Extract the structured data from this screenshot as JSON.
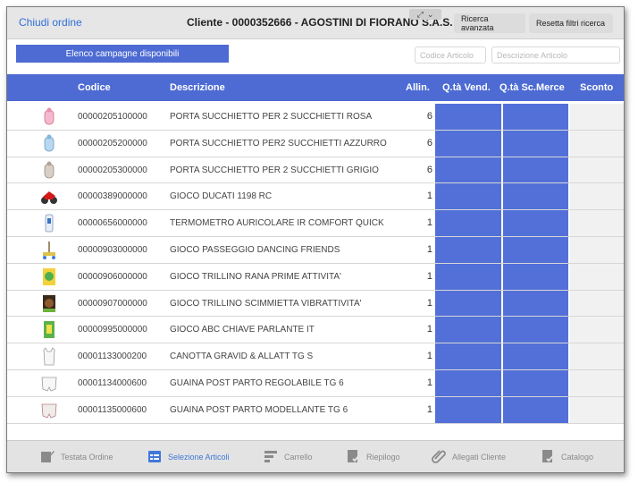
{
  "header": {
    "close_label": "Chiudi ordine",
    "client_title": "Cliente - 0000352666 - AGOSTINI DI FIORANO S.A.S.",
    "advanced_search_label": "Ricerca avanzata",
    "reset_filters_label": "Resetta filtri ricerca"
  },
  "toolbar": {
    "campaigns_label": "Elenco campagne disponibili",
    "code_placeholder": "Codice Articolo",
    "desc_placeholder": "Descrizione Articolo"
  },
  "table": {
    "columns": {
      "code": "Codice",
      "description": "Descrizione",
      "allin": "Allin.",
      "qty_sold": "Q.tà Vend.",
      "qty_discount": "Q.tà Sc.Merce",
      "discount": "Sconto"
    },
    "rows": [
      {
        "code": "00000205100000",
        "description": "PORTA SUCCHIETTO PER 2 SUCCHIETTI ROSA",
        "allin": "6",
        "thumb": "pacifier-holder-pink-icon"
      },
      {
        "code": "00000205200000",
        "description": "PORTA SUCCHIETTO PER2 SUCCHIETTI AZZURRO",
        "allin": "6",
        "thumb": "pacifier-holder-blue-icon"
      },
      {
        "code": "00000205300000",
        "description": "PORTA SUCCHIETTO PER 2 SUCCHIETTI GRIGIO",
        "allin": "6",
        "thumb": "pacifier-holder-grey-icon"
      },
      {
        "code": "00000389000000",
        "description": "GIOCO DUCATI 1198 RC",
        "allin": "1",
        "thumb": "motorbike-toy-icon"
      },
      {
        "code": "00000656000000",
        "description": "TERMOMETRO AURICOLARE IR COMFORT QUICK",
        "allin": "1",
        "thumb": "thermometer-icon"
      },
      {
        "code": "00000903000000",
        "description": "GIOCO PASSEGGIO DANCING FRIENDS",
        "allin": "1",
        "thumb": "stroller-toy-icon"
      },
      {
        "code": "00000906000000",
        "description": "GIOCO TRILLINO RANA PRIME ATTIVITA'",
        "allin": "1",
        "thumb": "frog-rattle-icon"
      },
      {
        "code": "00000907000000",
        "description": "GIOCO TRILLINO SCIMMIETTA VIBRATTIVITA'",
        "allin": "1",
        "thumb": "monkey-rattle-icon"
      },
      {
        "code": "00000995000000",
        "description": "GIOCO ABC CHIAVE PARLANTE IT",
        "allin": "1",
        "thumb": "key-toy-icon"
      },
      {
        "code": "00001133000200",
        "description": "CANOTTA GRAVID & ALLATT TG S",
        "allin": "1",
        "thumb": "tank-top-icon"
      },
      {
        "code": "00001134000600",
        "description": "GUAINA POST PARTO REGOLABILE TG 6",
        "allin": "1",
        "thumb": "girdle-icon"
      },
      {
        "code": "00001135000600",
        "description": "GUAINA POST PARTO MODELLANTE TG 6",
        "allin": "1",
        "thumb": "girdle-shaping-icon"
      }
    ]
  },
  "bottom_nav": {
    "items": [
      {
        "label": "Testata Ordine",
        "icon": "edit-icon"
      },
      {
        "label": "Selezione Articoli",
        "icon": "calendar-list-icon",
        "active": true
      },
      {
        "label": "Carrello",
        "icon": "list-lines-icon"
      },
      {
        "label": "Riepilogo",
        "icon": "summary-icon"
      },
      {
        "label": "Allegati Cliente",
        "icon": "paperclip-icon"
      },
      {
        "label": "Catalogo",
        "icon": "catalog-icon"
      }
    ]
  },
  "colors": {
    "accent": "#4d6bd3",
    "link": "#2f6fd9",
    "header_bg": "#e6e6e6",
    "nav_bg": "#e3e3e3"
  }
}
